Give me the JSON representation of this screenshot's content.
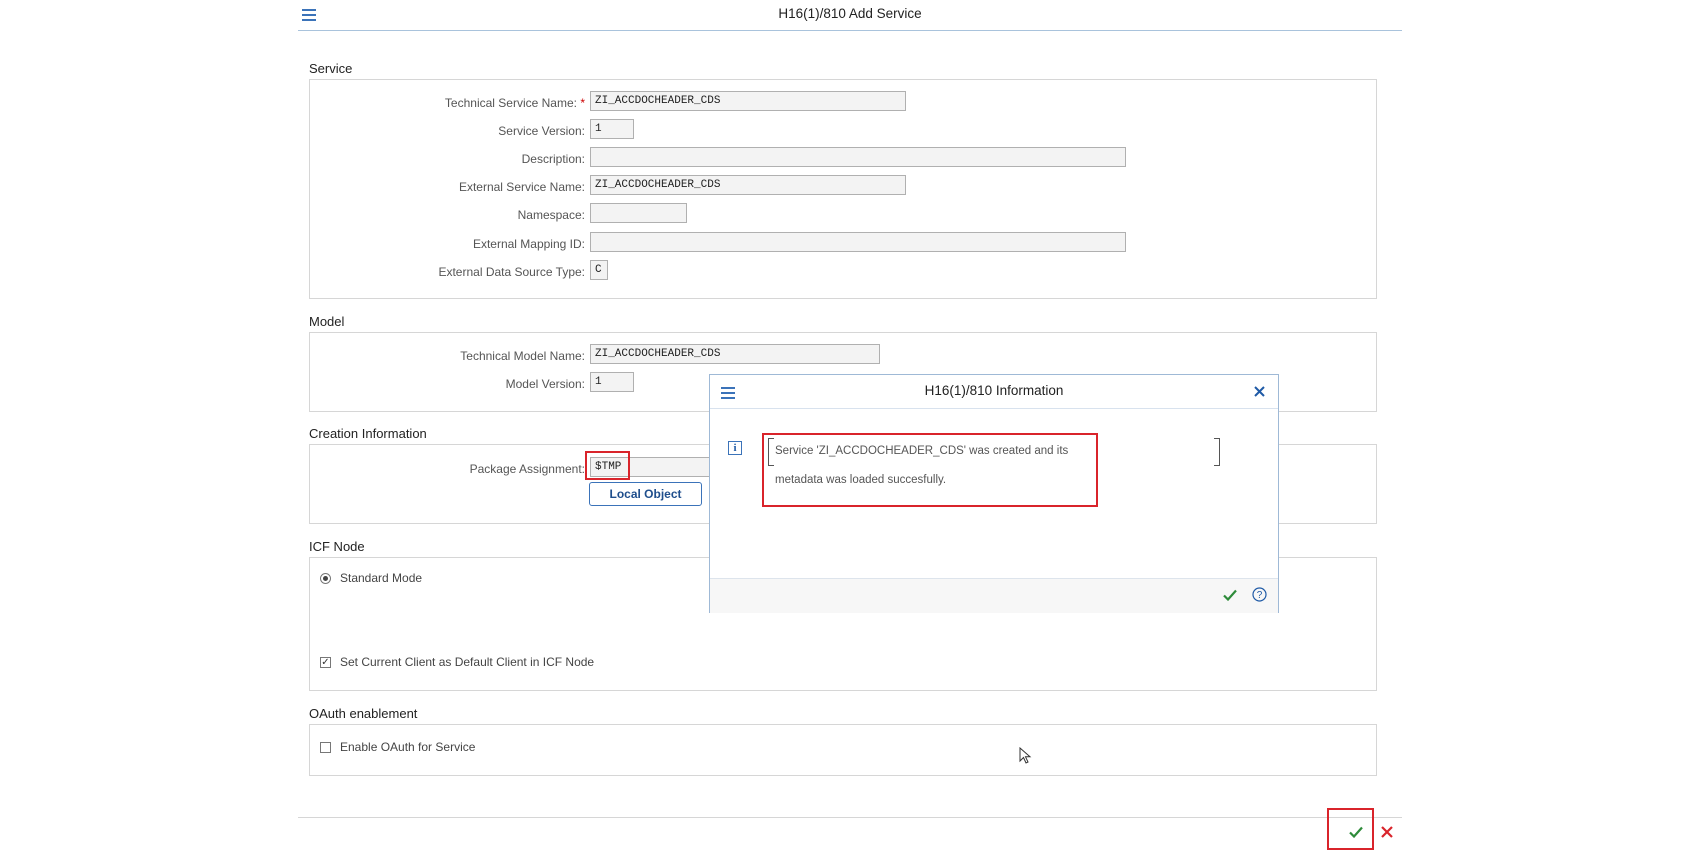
{
  "window": {
    "title": "H16(1)/810 Add Service"
  },
  "service": {
    "heading": "Service",
    "technical_service_name": {
      "label": "Technical Service Name:",
      "required_mark": "*",
      "value": "ZI_ACCDOCHEADER_CDS"
    },
    "service_version": {
      "label": "Service Version:",
      "value": "1"
    },
    "description": {
      "label": "Description:",
      "value": ""
    },
    "external_service_name": {
      "label": "External Service Name:",
      "value": "ZI_ACCDOCHEADER_CDS"
    },
    "namespace": {
      "label": "Namespace:",
      "value": ""
    },
    "external_mapping_id": {
      "label": "External Mapping ID:",
      "value": ""
    },
    "external_data_source_type": {
      "label": "External Data Source Type:",
      "value": "C"
    }
  },
  "model": {
    "heading": "Model",
    "technical_model_name": {
      "label": "Technical Model Name:",
      "value": "ZI_ACCDOCHEADER_CDS"
    },
    "model_version": {
      "label": "Model Version:",
      "value": "1"
    }
  },
  "creation": {
    "heading": "Creation Information",
    "package_assignment": {
      "label": "Package Assignment:",
      "value": "$TMP"
    },
    "local_object_button": "Local Object"
  },
  "icf": {
    "heading": "ICF Node",
    "standard_mode": "Standard Mode",
    "set_current_client": "Set Current Client as Default Client in ICF Node"
  },
  "oauth": {
    "heading": "OAuth enablement",
    "enable_oauth": "Enable OAuth for Service"
  },
  "dialog": {
    "title": "H16(1)/810 Information",
    "message_line1": "Service 'ZI_ACCDOCHEADER_CDS' was created and its",
    "message_line2": "metadata was loaded succesfully."
  },
  "icons": {
    "menu": "hamburger-menu-icon",
    "close": "close-icon",
    "info": "info-icon",
    "confirm": "checkmark-icon",
    "help": "help-icon",
    "cancel": "cancel-x-icon"
  },
  "colors": {
    "accent": "#3b73b9",
    "highlight": "#d9242b",
    "confirm": "#2e8b3a",
    "cancel": "#d9242b"
  }
}
